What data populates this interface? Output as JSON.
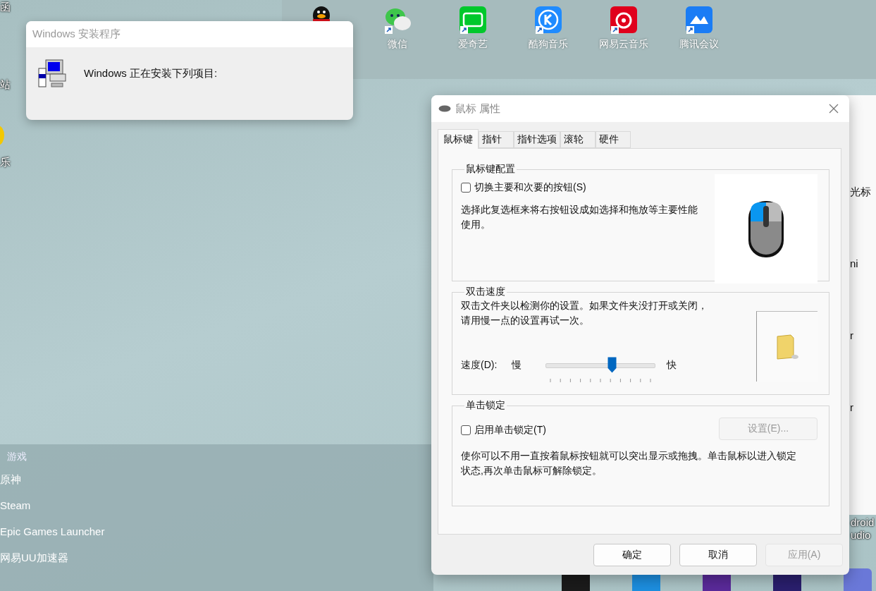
{
  "desktop": {
    "edge_labels": [
      "函",
      "站",
      "乐"
    ],
    "shortcuts": [
      {
        "label": "微信",
        "kind": "wechat"
      },
      {
        "label": "爱奇艺",
        "kind": "iqiyi"
      },
      {
        "label": "酷狗音乐",
        "kind": "kugou"
      },
      {
        "label": "网易云音乐",
        "kind": "netease"
      },
      {
        "label": "腾讯会议",
        "kind": "meeting"
      }
    ],
    "android_label_lines": [
      "droid",
      "udio"
    ]
  },
  "installer": {
    "title": "Windows 安装程序",
    "message": "Windows 正在安装下列项目:"
  },
  "start_panel": {
    "heading": "游戏",
    "items": [
      "原神",
      "Steam",
      "Epic Games Launcher",
      "网易UU加速器"
    ]
  },
  "background_window": {
    "texts": [
      "光标",
      "ni",
      "r",
      "r"
    ]
  },
  "mouse_properties": {
    "title": "鼠标 属性",
    "tabs": [
      {
        "label": "鼠标键",
        "selected": true
      },
      {
        "label": "指针",
        "selected": false
      },
      {
        "label": "指针选项",
        "selected": false
      },
      {
        "label": "滚轮",
        "selected": false
      },
      {
        "label": "硬件",
        "selected": false
      }
    ],
    "button_config": {
      "heading": "鼠标键配置",
      "checkbox": {
        "label": "切换主要和次要的按钮(S)",
        "checked": false
      },
      "description": "选择此复选框来将右按钮设成如选择和拖放等主要性能使用。"
    },
    "double_click": {
      "heading": "双击速度",
      "description": "双击文件夹以检测你的设置。如果文件夹没打开或关闭，请用慢一点的设置再试一次。",
      "speed_label": "速度(D):",
      "slow": "慢",
      "fast": "快",
      "level": 0.6
    },
    "click_lock": {
      "heading": "单击锁定",
      "checkbox": {
        "label": "启用单击锁定(T)",
        "checked": false
      },
      "settings_button": {
        "label": "设置(E)...",
        "disabled": true
      },
      "description": "使你可以不用一直按着鼠标按钮就可以突出显示或拖拽。单击鼠标以进入锁定状态,再次单击鼠标可解除锁定。"
    },
    "buttons": [
      {
        "label": "确定",
        "disabled": false
      },
      {
        "label": "取消",
        "disabled": false
      },
      {
        "label": "应用(A)",
        "disabled": true
      }
    ]
  }
}
